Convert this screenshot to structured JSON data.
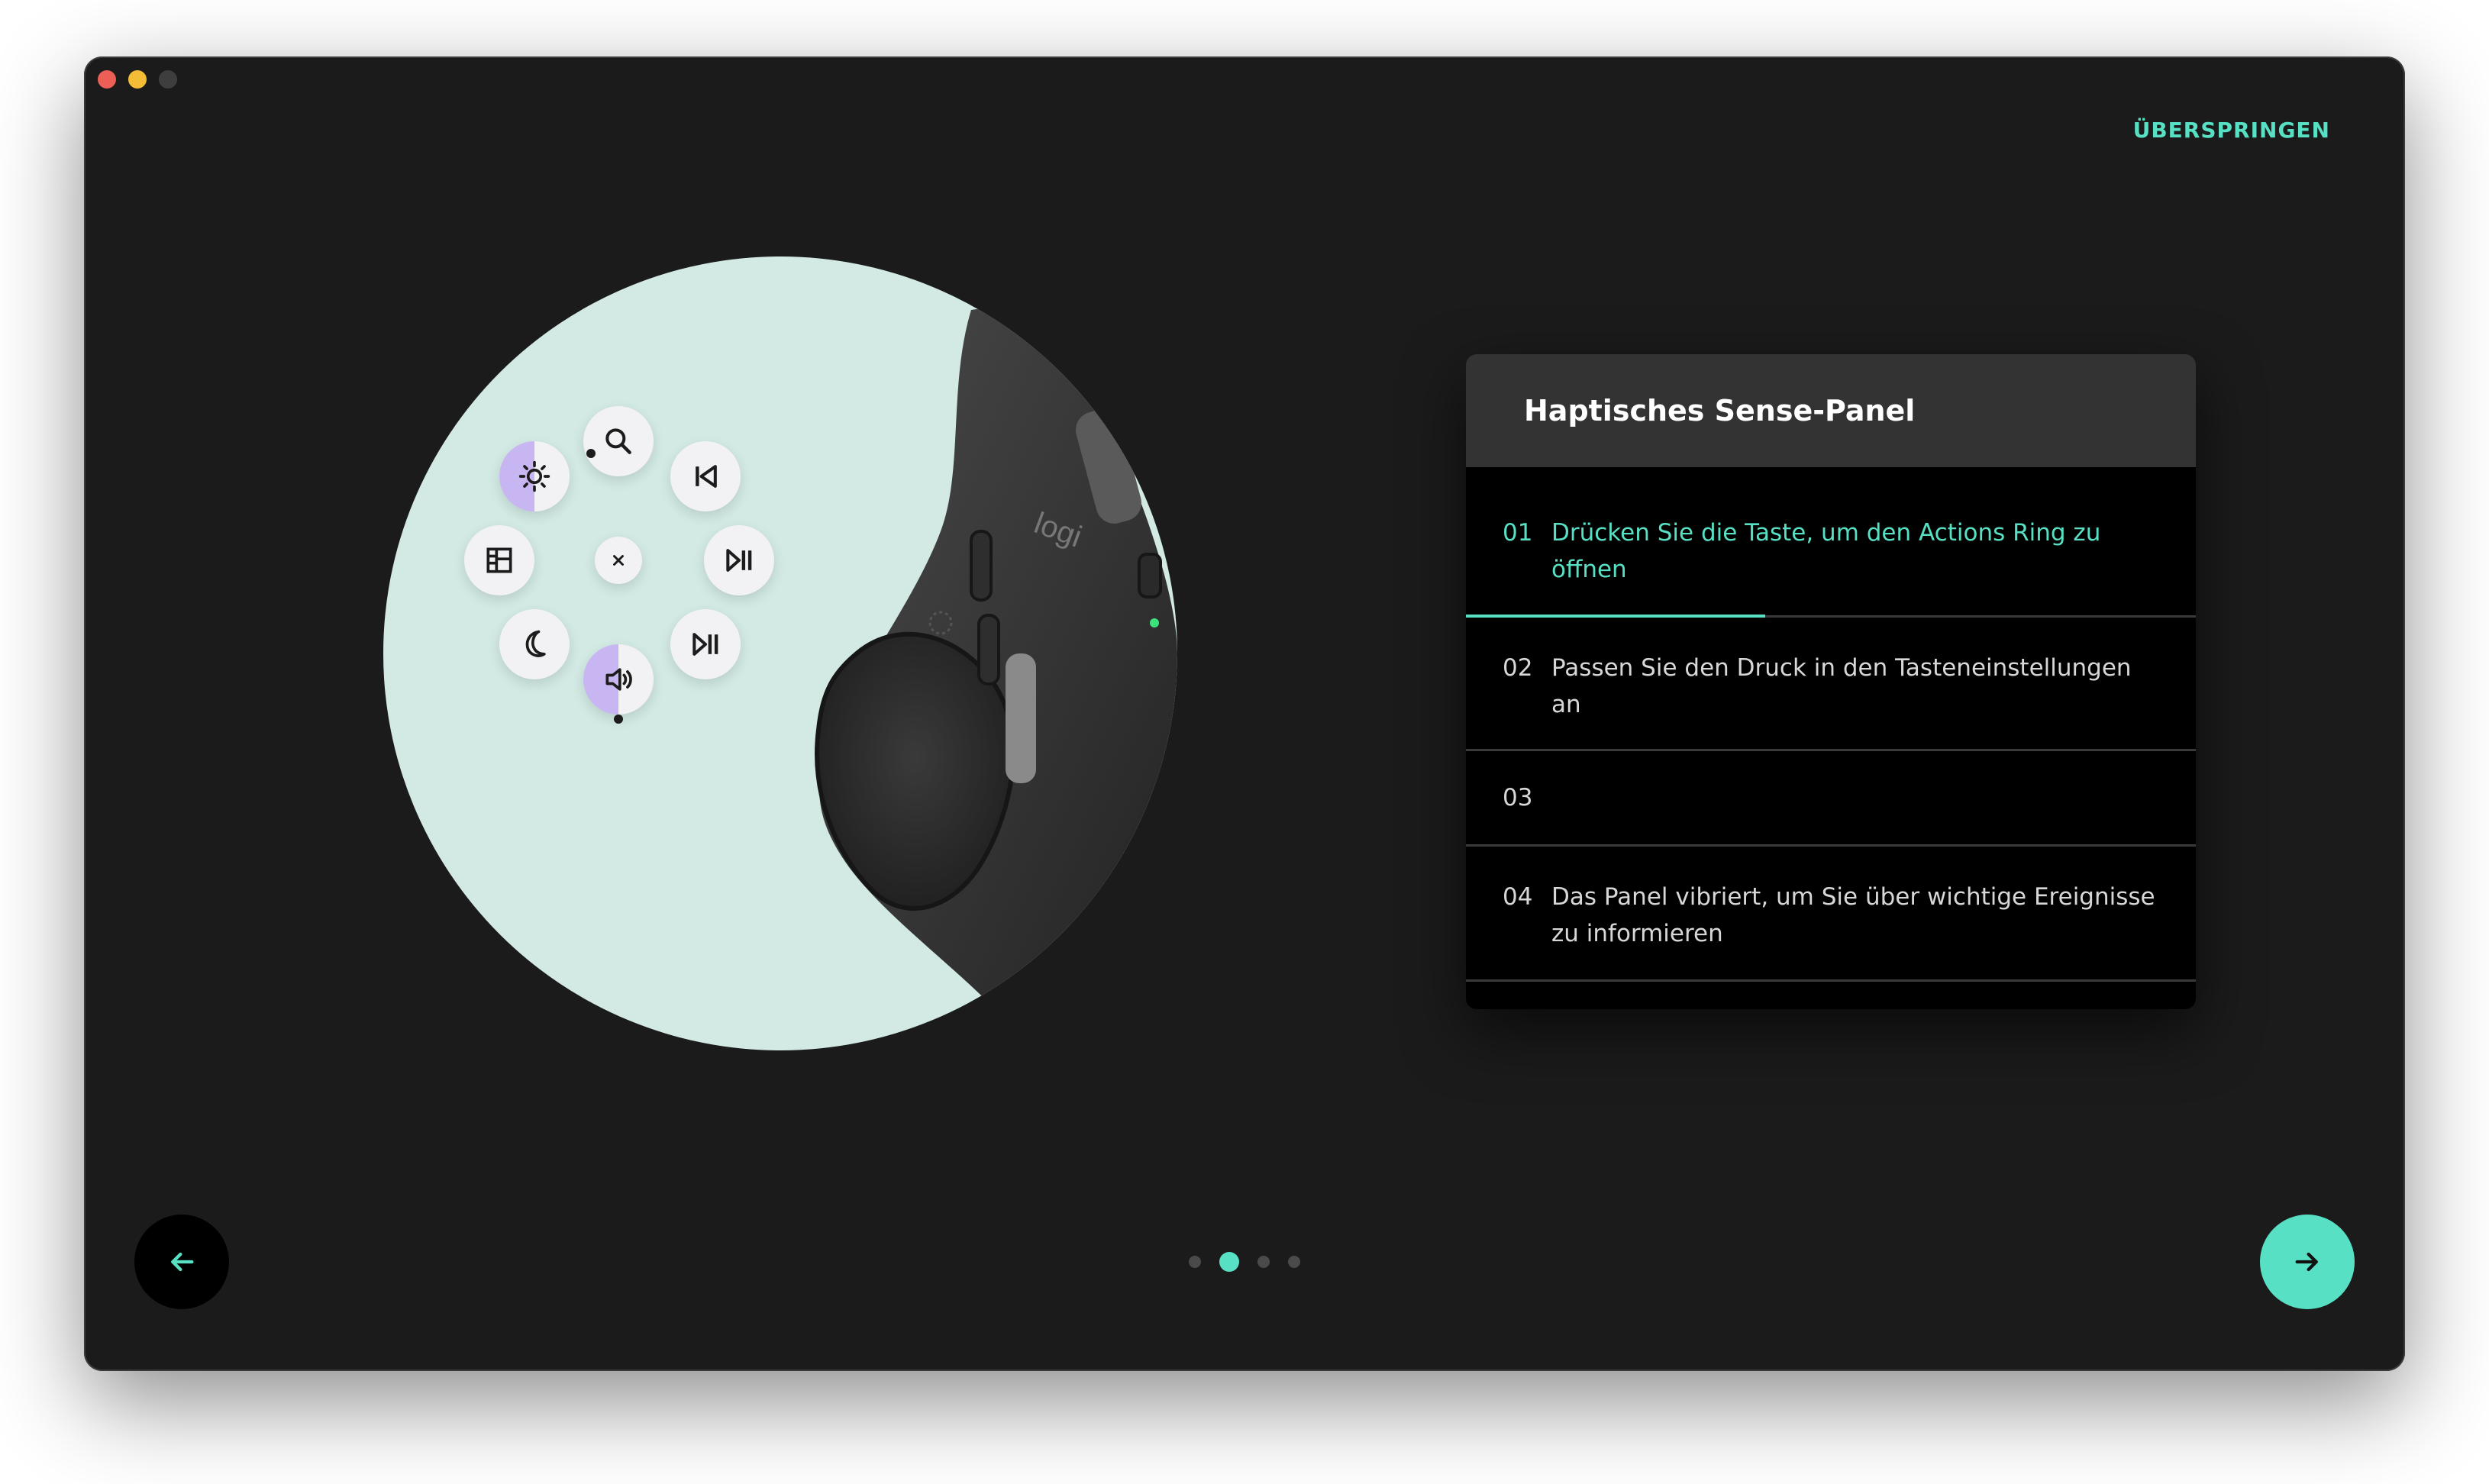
{
  "app": {
    "skip_label": "ÜBERSPRINGEN"
  },
  "card": {
    "title": "Haptisches Sense-Panel",
    "steps": [
      {
        "number": "01",
        "text": "Drücken Sie die Taste, um den Actions Ring zu öffnen",
        "active": true,
        "progress": 0.41
      },
      {
        "number": "02",
        "text": "Passen Sie den Druck in den Tasteneinstellungen an",
        "active": false
      },
      {
        "number": "03",
        "text": "",
        "active": false
      },
      {
        "number": "04",
        "text": "Das Panel vibriert, um Sie über wichtige Ereignisse zu informieren",
        "active": false
      }
    ]
  },
  "illustration": {
    "mouse_logo": "logi",
    "actions_ring_icons": [
      "search-icon",
      "previous-track-icon",
      "play-pause-icon",
      "play-pause-icon",
      "volume-icon",
      "moon-icon",
      "layout-icon",
      "brightness-icon",
      "close-icon"
    ]
  },
  "pager": {
    "total": 4,
    "current": 2
  },
  "colors": {
    "accent": "#58e0c5",
    "window_bg": "#1b1b1b",
    "card_header": "#333333",
    "illustration_bg": "#d2e9e4",
    "ring_highlight": "#c7b6f2"
  }
}
